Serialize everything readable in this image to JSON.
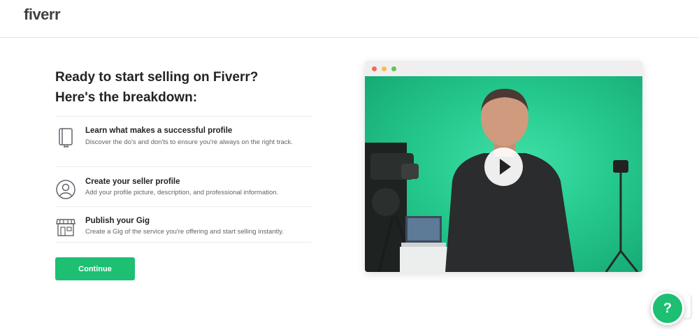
{
  "header": {
    "logo": "fiverr"
  },
  "heading": "Ready to start selling on Fiverr? Here's the breakdown:",
  "steps": [
    {
      "icon": "book-icon",
      "title": "Learn what makes a successful profile",
      "description": "Discover the do's and don'ts to ensure you're always on the right track."
    },
    {
      "icon": "user-profile-icon",
      "title": "Create your seller profile",
      "description": "Add your profile picture, description, and professional information."
    },
    {
      "icon": "storefront-icon",
      "title": "Publish your Gig",
      "description": "Create a Gig of the service you're offering and start selling instantly."
    }
  ],
  "continue_label": "Continue",
  "video": {
    "play_icon": "play-icon"
  },
  "help": {
    "label": "?"
  },
  "colors": {
    "brand": "#1dbf73",
    "heading": "#222325",
    "body": "#62646a"
  }
}
